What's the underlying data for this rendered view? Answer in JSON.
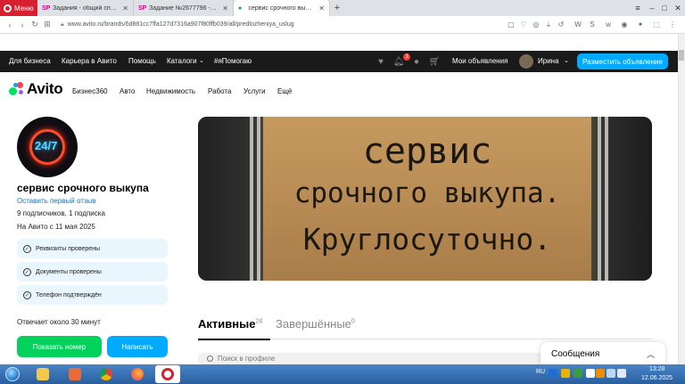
{
  "browser": {
    "menu_label": "Меню",
    "tabs": [
      {
        "favicon": "sp-icon",
        "title": "Задания - общий список"
      },
      {
        "favicon": "sp-icon",
        "title": "Задание №2677796 - про"
      },
      {
        "favicon": "avito-icon",
        "title": "сервис срочного выкупа"
      }
    ],
    "url": "www.avito.ru/brands/6d881cc7ffa127d7316a907f80ffb039/all/predlozheniya_uslug"
  },
  "topbar": {
    "links": [
      "Для бизнеса",
      "Карьера в Авито",
      "Помощь",
      "Каталоги",
      "#яПомогаю"
    ],
    "notification_count": "3",
    "my_ads": "Мои объявления",
    "user_name": "Ирина",
    "post_ad": "Разместить объявление"
  },
  "mainnav": {
    "logo_text": "Avito",
    "logo_colors": [
      "#04e061",
      "#ff4053",
      "#965eeb",
      "#0af"
    ],
    "items": [
      "Бизнес360",
      "Авто",
      "Недвижимость",
      "Работа",
      "Услуги",
      "Ещё"
    ]
  },
  "profile": {
    "avatar_text": "24/7",
    "name": "сервис срочного выкупа",
    "review_link": "Оставить первый отзыв",
    "followers": "9 подписчиков, 1 подписка",
    "since": "На Авито с 11 мая 2025",
    "verifications": [
      "Реквизиты проверены",
      "Документы проверены",
      "Телефон подтверждён"
    ],
    "reply_time": "Отвечает около 30 минут",
    "show_phone": "Показать номер",
    "write": "Написать"
  },
  "banner": {
    "lines": [
      "сервис",
      "срочного выкупа.",
      "Круглосуточно."
    ]
  },
  "listing": {
    "tab_active": "Активные",
    "tab_active_count": "24",
    "tab_done": "Завершённые",
    "tab_done_count": "0",
    "search_placeholder": "Поиск в профиле"
  },
  "messages": {
    "title": "Сообщения"
  },
  "taskbar": {
    "lang": "RU",
    "time": "13:28",
    "date": "12.06.2025"
  }
}
